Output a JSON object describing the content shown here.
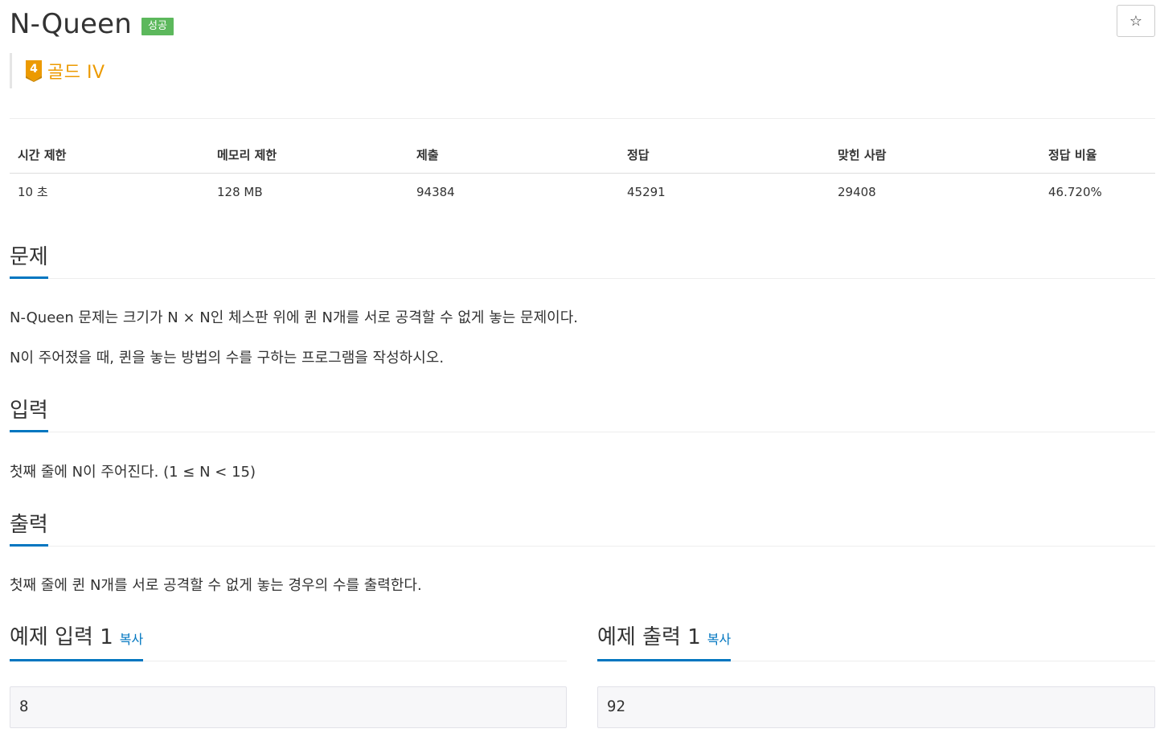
{
  "problem": {
    "title": "N-Queen",
    "status_badge": "성공",
    "tier_number": "4",
    "tier_label": "골드 IV",
    "tier_color": "#ec9a00"
  },
  "stats": {
    "headers": [
      "시간 제한",
      "메모리 제한",
      "제출",
      "정답",
      "맞힌 사람",
      "정답 비율"
    ],
    "values": [
      "10 초",
      "128 MB",
      "94384",
      "45291",
      "29408",
      "46.720%"
    ]
  },
  "sections": {
    "description": {
      "heading": "문제",
      "paragraphs": [
        "N-Queen 문제는 크기가 N × N인 체스판 위에 퀸 N개를 서로 공격할 수 없게 놓는 문제이다.",
        "N이 주어졌을 때, 퀸을 놓는 방법의 수를 구하는 프로그램을 작성하시오."
      ]
    },
    "input": {
      "heading": "입력",
      "text": "첫째 줄에 N이 주어진다. (1 ≤ N < 15)"
    },
    "output": {
      "heading": "출력",
      "text": "첫째 줄에 퀸 N개를 서로 공격할 수 없게 놓는 경우의 수를 출력한다."
    }
  },
  "samples": {
    "input": {
      "heading": "예제 입력 1",
      "copy_label": "복사",
      "value": "8"
    },
    "output": {
      "heading": "예제 출력 1",
      "copy_label": "복사",
      "value": "92"
    }
  },
  "colors": {
    "accent": "#0076c0",
    "success": "#5cb85c",
    "gold": "#ec9a00"
  },
  "icons": {
    "favorite": "star-outline-icon",
    "tier": "gold-tier-icon"
  }
}
